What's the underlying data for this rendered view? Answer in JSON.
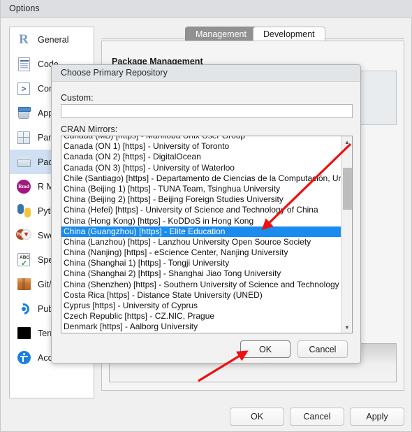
{
  "window": {
    "title": "Options"
  },
  "sidebar": {
    "items": [
      {
        "label": "General",
        "icon": "r-logo-icon",
        "selected": false
      },
      {
        "label": "Code",
        "icon": "code-document-icon",
        "selected": false
      },
      {
        "label": "Console",
        "icon": "console-prompt-icon",
        "selected": false
      },
      {
        "label": "Appearance",
        "icon": "paint-bucket-icon",
        "selected": false
      },
      {
        "label": "Pane Layout",
        "icon": "pane-grid-icon",
        "selected": false
      },
      {
        "label": "Packages",
        "icon": "package-box-icon",
        "selected": true
      },
      {
        "label": "R Markdown",
        "icon": "rmd-badge-icon",
        "selected": false
      },
      {
        "label": "Python",
        "icon": "python-logo-icon",
        "selected": false
      },
      {
        "label": "Sweave",
        "icon": "sweave-pdf-icon",
        "selected": false
      },
      {
        "label": "Spelling",
        "icon": "spellcheck-icon",
        "selected": false
      },
      {
        "label": "Git/SVN",
        "icon": "git-box-icon",
        "selected": false
      },
      {
        "label": "Publishing",
        "icon": "publish-orbit-icon",
        "selected": false
      },
      {
        "label": "Terminal",
        "icon": "terminal-icon",
        "selected": false
      },
      {
        "label": "Accessibility",
        "icon": "accessibility-icon",
        "selected": false
      }
    ]
  },
  "tabs": [
    {
      "label": "Management",
      "active": true
    },
    {
      "label": "Development",
      "active": false
    }
  ],
  "main": {
    "section_heading": "Package Management"
  },
  "footer": {
    "ok": "OK",
    "cancel": "Cancel",
    "apply": "Apply"
  },
  "modal": {
    "title": "Choose Primary Repository",
    "custom_label": "Custom:",
    "custom_value": "",
    "custom_placeholder": "",
    "mirrors_label": "CRAN Mirrors:",
    "selected_index": 9,
    "mirrors": [
      "Canada (MB) [https] - Manitoba Unix User Group",
      "Canada (ON 1) [https] - University of Toronto",
      "Canada (ON 2) [https] - DigitalOcean",
      "Canada (ON 3) [https] - University of Waterloo",
      "Chile (Santiago) [https] - Departamento de Ciencias de la Computación, Un",
      "China (Beijing 1) [https] - TUNA Team, Tsinghua University",
      "China (Beijing 2) [https] - Beijing Foreign Studies University",
      "China (Hefei) [https] - University of Science and Technology of China",
      "China (Hong Kong) [https] - KoDDoS in Hong Kong",
      "China (Guangzhou) [https] - Elite Education",
      "China (Lanzhou) [https] - Lanzhou University Open Source Society",
      "China (Nanjing) [https] - eScience Center, Nanjing University",
      "China (Shanghai 1) [https] - Tongji University",
      "China (Shanghai 2) [https] - Shanghai Jiao Tong University",
      "China (Shenzhen) [https] - Southern University of Science and Technology",
      "Costa Rica [https] - Distance State University (UNED)",
      "Cyprus [https] - University of Cyprus",
      "Czech Republic [https] - CZ.NIC, Prague",
      "Denmark [https] - Aalborg University"
    ],
    "ok": "OK",
    "cancel": "Cancel"
  },
  "colors": {
    "selection_blue": "#1a8cf0",
    "sidebar_selected": "#cfe0f2",
    "annotation_red": "#ee1111",
    "active_tab": "#919191"
  }
}
